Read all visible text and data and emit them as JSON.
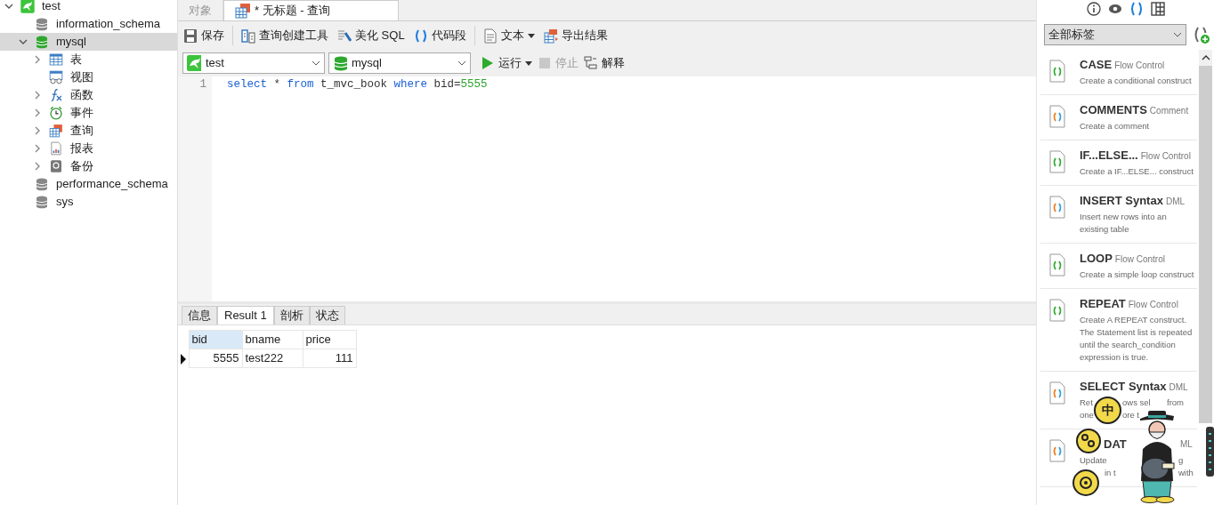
{
  "sidebar": {
    "tree": [
      {
        "label": "test",
        "kind": "connection",
        "expanded": true,
        "selected": false,
        "children": [
          {
            "label": "information_schema",
            "kind": "database",
            "selected": false
          },
          {
            "label": "mysql",
            "kind": "database-open",
            "selected": true,
            "expanded": true,
            "children": [
              {
                "label": "表",
                "kind": "table",
                "expanded": false
              },
              {
                "label": "视图",
                "kind": "view"
              },
              {
                "label": "函数",
                "kind": "function",
                "expanded": false
              },
              {
                "label": "事件",
                "kind": "event",
                "expanded": false
              },
              {
                "label": "查询",
                "kind": "query",
                "expanded": false
              },
              {
                "label": "报表",
                "kind": "report",
                "expanded": false
              },
              {
                "label": "备份",
                "kind": "backup",
                "expanded": false
              }
            ]
          },
          {
            "label": "performance_schema",
            "kind": "database",
            "selected": false
          },
          {
            "label": "sys",
            "kind": "database",
            "selected": false
          }
        ]
      }
    ]
  },
  "tabs": [
    {
      "label": "对象",
      "selected": false
    },
    {
      "label": "* 无标题 - 查询",
      "selected": true
    }
  ],
  "toolbar": [
    {
      "label": "保存",
      "kind": "save"
    },
    {
      "kind": "separator"
    },
    {
      "label": "查询创建工具",
      "kind": "builder"
    },
    {
      "label": "美化 SQL",
      "kind": "beautify"
    },
    {
      "label": "代码段",
      "kind": "snippet"
    },
    {
      "kind": "separator"
    },
    {
      "label": "文本",
      "kind": "text",
      "dropdown": true
    },
    {
      "label": "导出结果",
      "kind": "export"
    }
  ],
  "connection_bar": {
    "connection": "test",
    "database": "mysql",
    "actions": [
      {
        "label": "运行",
        "kind": "run",
        "dropdown": true,
        "disabled": false
      },
      {
        "label": "停止",
        "kind": "stop",
        "disabled": true
      },
      {
        "label": "解释",
        "kind": "explain",
        "disabled": false
      }
    ]
  },
  "editor": {
    "lines": [
      {
        "number": "1",
        "tokens": [
          {
            "text": "select",
            "kind": "keyword"
          },
          {
            "text": " * ",
            "kind": "plain"
          },
          {
            "text": "from",
            "kind": "keyword"
          },
          {
            "text": " t_mvc_book ",
            "kind": "plain"
          },
          {
            "text": "where",
            "kind": "keyword"
          },
          {
            "text": " bid=",
            "kind": "plain"
          },
          {
            "text": "5555",
            "kind": "number"
          }
        ]
      }
    ]
  },
  "result_tabs": [
    {
      "label": "信息",
      "selected": false
    },
    {
      "label": "Result 1",
      "selected": true
    },
    {
      "label": "剖析",
      "selected": false
    },
    {
      "label": "状态",
      "selected": false
    }
  ],
  "table": {
    "columns": [
      {
        "label": "bid",
        "selected": true,
        "kind": "number"
      },
      {
        "label": "bname",
        "selected": false,
        "kind": "text"
      },
      {
        "label": "price",
        "selected": false,
        "kind": "number"
      }
    ],
    "rows": [
      {
        "current": true,
        "cells": [
          "5555",
          "test222",
          "111"
        ]
      }
    ]
  },
  "snippets_panel": {
    "filter": "全部标签",
    "items": [
      {
        "title": "CASE",
        "category": "Flow Control",
        "kind": "control",
        "description": [
          [
            "Create a conditional construct"
          ]
        ]
      },
      {
        "title": "COMMENTS",
        "category": "Comment",
        "kind": "statement",
        "description": [
          [
            "Create a comment"
          ]
        ]
      },
      {
        "title": "IF...ELSE...",
        "category": "Flow Control",
        "kind": "control",
        "description": [
          [
            "Create a IF...ELSE... construct"
          ]
        ]
      },
      {
        "title": "INSERT Syntax",
        "category": "DML",
        "kind": "statement",
        "description": [
          [
            "Insert new rows into an"
          ],
          [
            "existing table"
          ]
        ]
      },
      {
        "title": "LOOP",
        "category": "Flow Control",
        "kind": "control",
        "description": [
          [
            "Create a simple loop construct"
          ]
        ]
      },
      {
        "title": "REPEAT",
        "category": "Flow Control",
        "kind": "control",
        "description": [
          [
            "Create A REPEAT construct."
          ],
          [
            "The Statement list is repeated"
          ],
          [
            "until the search_condition"
          ],
          [
            "expression is true."
          ]
        ]
      },
      {
        "title": "SELECT Syntax",
        "category": "DML",
        "kind": "statement",
        "description": [
          [
            "Ret",
            "ows sel",
            "from"
          ],
          [
            "one",
            "ore t"
          ]
        ]
      },
      {
        "title_visible": "DAT",
        "category": "ML",
        "kind": "statement",
        "description": [
          [
            "Update",
            "g"
          ],
          [
            "in t",
            "with"
          ]
        ]
      }
    ]
  },
  "overlay": {
    "ime_label": "中"
  }
}
